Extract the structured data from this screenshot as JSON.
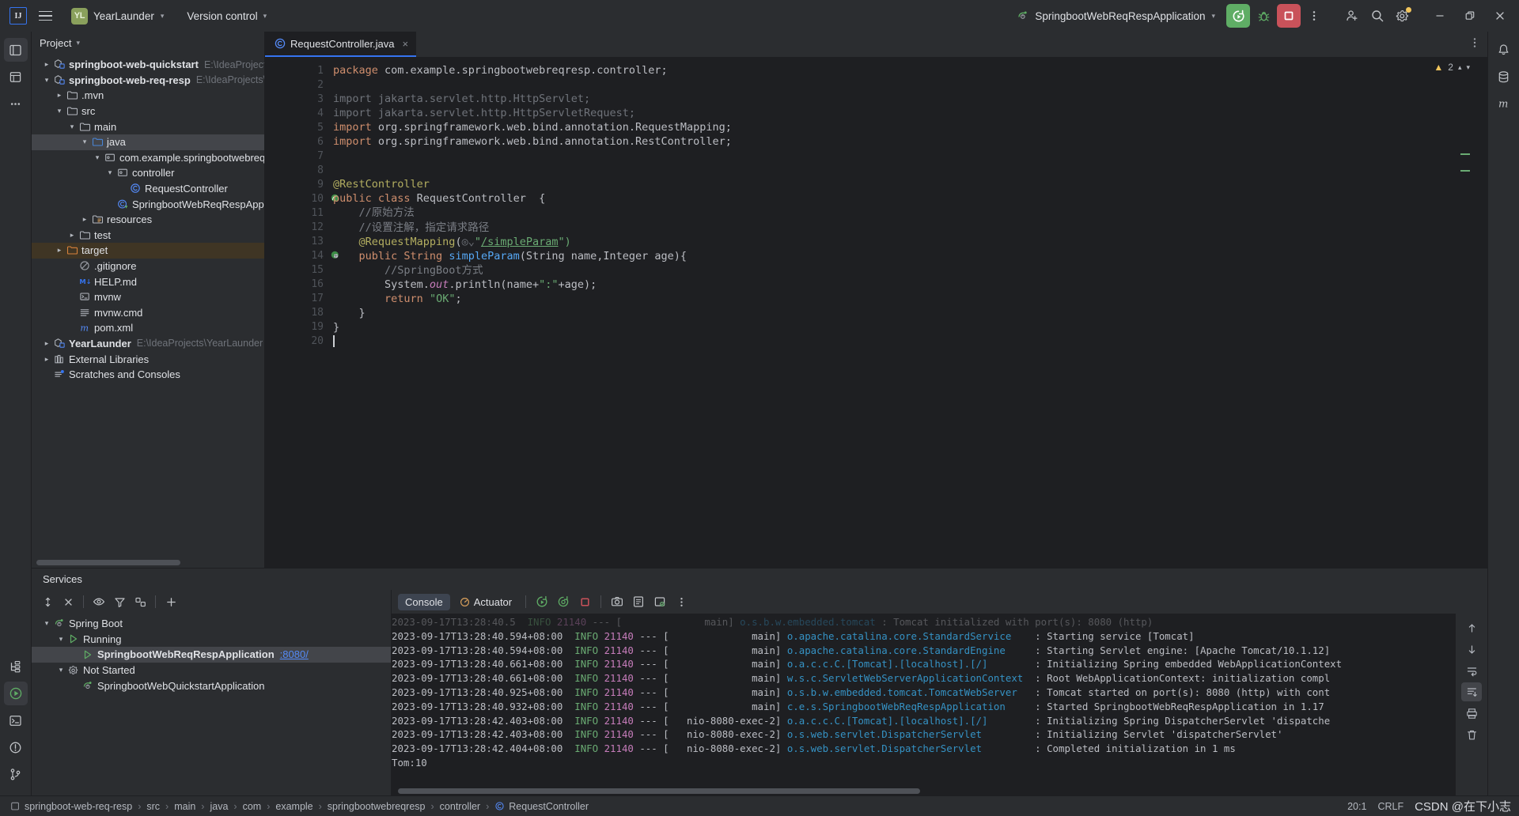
{
  "titlebar": {
    "logo": "IJ",
    "menu_icon": "hamburger-icon",
    "project_badge": "YL",
    "project_name": "YearLaunder",
    "version_control": "Version control",
    "run_config": "SpringbootWebReqRespApplication",
    "buttons": {
      "run": "run-icon",
      "debug": "debug-icon",
      "stop": "stop-icon",
      "more": "more-vertical-icon",
      "share": "add-user-icon",
      "search": "search-icon",
      "settings": "gear-icon",
      "minimize": "minimize-icon",
      "maximize": "maximize-icon",
      "close": "close-icon"
    }
  },
  "project_panel": {
    "header": "Project",
    "tree": [
      {
        "depth": 0,
        "arrow": "collapsed",
        "icon": "module-icon",
        "label": "springboot-web-quickstart",
        "bold": true,
        "path": "E:\\IdeaProjects\\Spring"
      },
      {
        "depth": 0,
        "arrow": "expanded",
        "icon": "module-icon",
        "label": "springboot-web-req-resp",
        "bold": true,
        "path": "E:\\IdeaProjects\\SpringB"
      },
      {
        "depth": 1,
        "arrow": "collapsed",
        "icon": "folder-icon",
        "label": ".mvn",
        "bold": false,
        "path": ""
      },
      {
        "depth": 1,
        "arrow": "expanded",
        "icon": "folder-icon",
        "label": "src",
        "bold": false,
        "path": ""
      },
      {
        "depth": 2,
        "arrow": "expanded",
        "icon": "folder-icon",
        "label": "main",
        "bold": false,
        "path": ""
      },
      {
        "depth": 3,
        "arrow": "expanded",
        "icon": "source-folder-icon",
        "label": "java",
        "bold": false,
        "path": "",
        "selected": true
      },
      {
        "depth": 4,
        "arrow": "expanded",
        "icon": "package-icon",
        "label": "com.example.springbootwebreqresp",
        "bold": false,
        "path": ""
      },
      {
        "depth": 5,
        "arrow": "expanded",
        "icon": "package-icon",
        "label": "controller",
        "bold": false,
        "path": ""
      },
      {
        "depth": 6,
        "arrow": "none",
        "icon": "class-icon",
        "label": "RequestController",
        "bold": false,
        "path": ""
      },
      {
        "depth": 5,
        "arrow": "none",
        "icon": "spring-class-icon",
        "label": "SpringbootWebReqRespApplication",
        "bold": false,
        "path": ""
      },
      {
        "depth": 3,
        "arrow": "collapsed",
        "icon": "resources-folder-icon",
        "label": "resources",
        "bold": false,
        "path": ""
      },
      {
        "depth": 2,
        "arrow": "collapsed",
        "icon": "folder-icon",
        "label": "test",
        "bold": false,
        "path": ""
      },
      {
        "depth": 1,
        "arrow": "collapsed",
        "icon": "target-folder-icon",
        "label": "target",
        "bold": false,
        "path": "",
        "target": true
      },
      {
        "depth": 2,
        "arrow": "none",
        "icon": "gitignore-icon",
        "label": ".gitignore",
        "bold": false,
        "path": ""
      },
      {
        "depth": 2,
        "arrow": "none",
        "icon": "markdown-icon",
        "label": "HELP.md",
        "bold": false,
        "path": ""
      },
      {
        "depth": 2,
        "arrow": "none",
        "icon": "shell-icon",
        "label": "mvnw",
        "bold": false,
        "path": ""
      },
      {
        "depth": 2,
        "arrow": "none",
        "icon": "text-icon",
        "label": "mvnw.cmd",
        "bold": false,
        "path": ""
      },
      {
        "depth": 2,
        "arrow": "none",
        "icon": "maven-icon",
        "label": "pom.xml",
        "bold": false,
        "path": ""
      },
      {
        "depth": 0,
        "arrow": "collapsed",
        "icon": "module-icon",
        "label": "YearLaunder",
        "bold": true,
        "path": "E:\\IdeaProjects\\YearLaunder"
      },
      {
        "depth": 0,
        "arrow": "collapsed",
        "icon": "library-icon",
        "label": "External Libraries",
        "bold": false,
        "path": ""
      },
      {
        "depth": 0,
        "arrow": "none",
        "icon": "scratches-icon",
        "label": "Scratches and Consoles",
        "bold": false,
        "path": ""
      }
    ]
  },
  "editor": {
    "tab": {
      "label": "RequestController.java",
      "icon": "java-class-icon",
      "close": "×"
    },
    "warnings": {
      "count": "2",
      "icon": "warning-triangle-icon"
    },
    "cursor_line": 20,
    "lines": [
      {
        "n": 1,
        "tokens": [
          {
            "t": "package ",
            "c": "kw"
          },
          {
            "t": "com.example.springbootwebreqresp.controller;",
            "c": "plain"
          }
        ]
      },
      {
        "n": 2,
        "tokens": []
      },
      {
        "n": 3,
        "tokens": [
          {
            "t": "import jakarta.servlet.http.HttpServlet;",
            "c": "fade"
          }
        ]
      },
      {
        "n": 4,
        "tokens": [
          {
            "t": "import jakarta.servlet.http.HttpServletRequest;",
            "c": "fade"
          }
        ]
      },
      {
        "n": 5,
        "tokens": [
          {
            "t": "import ",
            "c": "kw"
          },
          {
            "t": "org.springframework.web.bind.annotation.",
            "c": "plain"
          },
          {
            "t": "RequestMapping;",
            "c": "plain"
          }
        ]
      },
      {
        "n": 6,
        "tokens": [
          {
            "t": "import ",
            "c": "kw"
          },
          {
            "t": "org.springframework.web.bind.annotation.",
            "c": "plain"
          },
          {
            "t": "RestController;",
            "c": "plain"
          }
        ]
      },
      {
        "n": 7,
        "tokens": []
      },
      {
        "n": 8,
        "tokens": []
      },
      {
        "n": 9,
        "tokens": [
          {
            "t": "@RestController",
            "c": "ann"
          }
        ]
      },
      {
        "n": 10,
        "tokens": [
          {
            "t": "public class ",
            "c": "kw"
          },
          {
            "t": "RequestController  {",
            "c": "plain"
          }
        ],
        "gutter_icon": "bean-icon"
      },
      {
        "n": 11,
        "tokens": [
          {
            "t": "    //原始方法",
            "c": "cmt"
          }
        ]
      },
      {
        "n": 12,
        "tokens": [
          {
            "t": "    //设置注解，指定请求路径",
            "c": "cmt"
          }
        ]
      },
      {
        "n": 13,
        "tokens": [
          {
            "t": "    ",
            "c": "plain"
          },
          {
            "t": "@RequestMapping",
            "c": "ann"
          },
          {
            "t": "(",
            "c": "plain"
          },
          {
            "t": "◎⌄",
            "c": "fade"
          },
          {
            "t": "\"",
            "c": "str"
          },
          {
            "t": "/simpleParam",
            "c": "path-str"
          },
          {
            "t": "\")",
            "c": "str"
          }
        ]
      },
      {
        "n": 14,
        "tokens": [
          {
            "t": "    ",
            "c": "plain"
          },
          {
            "t": "public String ",
            "c": "kw"
          },
          {
            "t": "simpleParam",
            "c": "meth"
          },
          {
            "t": "(String name,Integer age){",
            "c": "plain"
          }
        ],
        "gutter_icon": "web-bean-icon"
      },
      {
        "n": 15,
        "tokens": [
          {
            "t": "        //SpringBoot方式",
            "c": "cmt"
          }
        ]
      },
      {
        "n": 16,
        "tokens": [
          {
            "t": "        System.",
            "c": "plain"
          },
          {
            "t": "out",
            "c": "field"
          },
          {
            "t": ".println(name+",
            "c": "plain"
          },
          {
            "t": "\":\"",
            "c": "str"
          },
          {
            "t": "+age);",
            "c": "plain"
          }
        ]
      },
      {
        "n": 17,
        "tokens": [
          {
            "t": "        ",
            "c": "plain"
          },
          {
            "t": "return ",
            "c": "kw"
          },
          {
            "t": "\"OK\"",
            "c": "str"
          },
          {
            "t": ";",
            "c": "plain"
          }
        ]
      },
      {
        "n": 18,
        "tokens": [
          {
            "t": "    }",
            "c": "plain"
          }
        ]
      },
      {
        "n": 19,
        "tokens": [
          {
            "t": "}",
            "c": "plain"
          }
        ]
      },
      {
        "n": 20,
        "tokens": []
      }
    ]
  },
  "services": {
    "header": "Services",
    "toolbar_icons": [
      "expand-all-icon",
      "collapse-all-icon",
      "show-icon",
      "filter-icon",
      "group-icon",
      "add-icon"
    ],
    "tree": [
      {
        "depth": 0,
        "arrow": "expanded",
        "icon": "spring-icon",
        "label": "Spring Boot",
        "port": "",
        "selected": false
      },
      {
        "depth": 1,
        "arrow": "expanded",
        "icon": "run-green-icon",
        "label": "Running",
        "port": "",
        "selected": false
      },
      {
        "depth": 2,
        "arrow": "none",
        "icon": "run-green-icon",
        "label": "SpringbootWebReqRespApplication",
        "port": ":8080/",
        "selected": true,
        "bold": true
      },
      {
        "depth": 1,
        "arrow": "expanded",
        "icon": "gear-icon",
        "label": "Not Started",
        "port": "",
        "selected": false
      },
      {
        "depth": 2,
        "arrow": "none",
        "icon": "spring-icon",
        "label": "SpringbootWebQuickstartApplication",
        "port": "",
        "selected": false
      }
    ],
    "console_tabs": [
      {
        "label": "Console",
        "icon": "",
        "active": true
      },
      {
        "label": "Actuator",
        "icon": "actuator-icon",
        "active": false
      }
    ],
    "console_toolbar": [
      "rerun-icon",
      "rerun-failed-icon",
      "stop-red-icon",
      "camera-icon",
      "dump-icon",
      "gc-icon",
      "more-vertical-icon"
    ],
    "console_side_icons": [
      "scroll-up-icon",
      "scroll-down-icon",
      "soft-wrap-icon",
      "scroll-end-icon",
      "print-icon",
      "trash-icon"
    ],
    "console_lines": [
      {
        "ts": "",
        "level": "",
        "pid": "",
        "thread": "",
        "logger": "",
        "msg": "",
        "partial": true
      },
      {
        "ts": "2023-09-17T13:28:40.594+08:00",
        "level": "INFO",
        "pid": "21140",
        "thread": "main",
        "logger": "o.apache.catalina.core.StandardService",
        "msg": "Starting service [Tomcat]"
      },
      {
        "ts": "2023-09-17T13:28:40.594+08:00",
        "level": "INFO",
        "pid": "21140",
        "thread": "main",
        "logger": "o.apache.catalina.core.StandardEngine",
        "msg": "Starting Servlet engine: [Apache Tomcat/10.1.12]"
      },
      {
        "ts": "2023-09-17T13:28:40.661+08:00",
        "level": "INFO",
        "pid": "21140",
        "thread": "main",
        "logger": "o.a.c.c.C.[Tomcat].[localhost].[/]",
        "msg": "Initializing Spring embedded WebApplicationContext"
      },
      {
        "ts": "2023-09-17T13:28:40.661+08:00",
        "level": "INFO",
        "pid": "21140",
        "thread": "main",
        "logger": "w.s.c.ServletWebServerApplicationContext",
        "msg": "Root WebApplicationContext: initialization compl"
      },
      {
        "ts": "2023-09-17T13:28:40.925+08:00",
        "level": "INFO",
        "pid": "21140",
        "thread": "main",
        "logger": "o.s.b.w.embedded.tomcat.TomcatWebServer",
        "msg": "Tomcat started on port(s): 8080 (http) with cont"
      },
      {
        "ts": "2023-09-17T13:28:40.932+08:00",
        "level": "INFO",
        "pid": "21140",
        "thread": "main",
        "logger": "c.e.s.SpringbootWebReqRespApplication",
        "msg": "Started SpringbootWebReqRespApplication in 1.17 "
      },
      {
        "ts": "2023-09-17T13:28:42.403+08:00",
        "level": "INFO",
        "pid": "21140",
        "thread": "nio-8080-exec-2",
        "logger": "o.a.c.c.C.[Tomcat].[localhost].[/]",
        "msg": "Initializing Spring DispatcherServlet 'dispatche"
      },
      {
        "ts": "2023-09-17T13:28:42.403+08:00",
        "level": "INFO",
        "pid": "21140",
        "thread": "nio-8080-exec-2",
        "logger": "o.s.web.servlet.DispatcherServlet",
        "msg": "Initializing Servlet 'dispatcherServlet'"
      },
      {
        "ts": "2023-09-17T13:28:42.404+08:00",
        "level": "INFO",
        "pid": "21140",
        "thread": "nio-8080-exec-2",
        "logger": "o.s.web.servlet.DispatcherServlet",
        "msg": "Completed initialization in 1 ms"
      }
    ],
    "console_output": "Tom:10"
  },
  "statusbar": {
    "breadcrumbs": [
      {
        "label": "springboot-web-req-resp",
        "icon": "module-icon"
      },
      {
        "label": "src",
        "icon": ""
      },
      {
        "label": "main",
        "icon": ""
      },
      {
        "label": "java",
        "icon": ""
      },
      {
        "label": "com",
        "icon": ""
      },
      {
        "label": "example",
        "icon": ""
      },
      {
        "label": "springbootwebreqresp",
        "icon": ""
      },
      {
        "label": "controller",
        "icon": ""
      },
      {
        "label": "RequestController",
        "icon": "class-icon"
      }
    ],
    "caret_position": "20:1",
    "line_separator": "CRLF",
    "watermark": "CSDN @在下小志"
  },
  "left_rail_icons": [
    "project-icon",
    "commit-icon",
    "more-dots-icon",
    "structure-icon",
    "run-services-icon",
    "terminal-icon",
    "problems-icon",
    "git-branch-icon"
  ],
  "right_rail_icons": [
    "notifications-icon",
    "database-icon",
    "maven-m-icon"
  ],
  "colors": {
    "accent_blue": "#3574f0",
    "run_green": "#5fad65",
    "stop_red": "#c9525a",
    "bg_panel": "#2b2d30",
    "bg_editor": "#1e1f22",
    "selection": "#43454a",
    "target_highlight": "#3f3524"
  }
}
